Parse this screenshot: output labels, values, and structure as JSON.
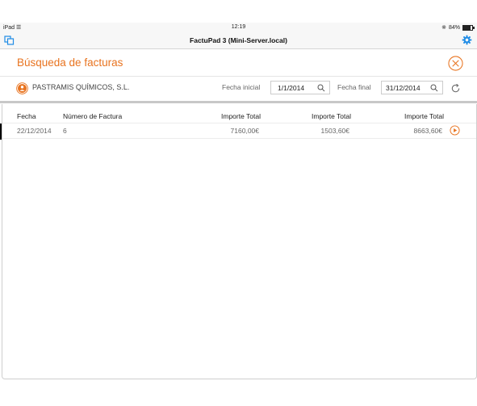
{
  "status_bar": {
    "device": "iPad",
    "time": "12:19",
    "battery": "84%"
  },
  "app": {
    "title": "FactuPad 3 (Mini-Server.local)"
  },
  "page": {
    "title": "Búsqueda de facturas"
  },
  "filter": {
    "client": "PASTRAMIS QUÍMICOS, S.L.",
    "start_label": "Fecha inicial",
    "start_value": "1/1/2014",
    "end_label": "Fecha final",
    "end_value": "31/12/2014"
  },
  "table": {
    "headers": [
      "Fecha",
      "Número de Factura",
      "Importe Total",
      "Importe Total",
      "Importe Total"
    ],
    "rows": [
      [
        "22/12/2014",
        "6",
        "7160,00€",
        "1503,60€",
        "8663,60€"
      ]
    ]
  },
  "colors": {
    "accent": "#e8731f",
    "ios_blue": "#1f8ce6"
  }
}
